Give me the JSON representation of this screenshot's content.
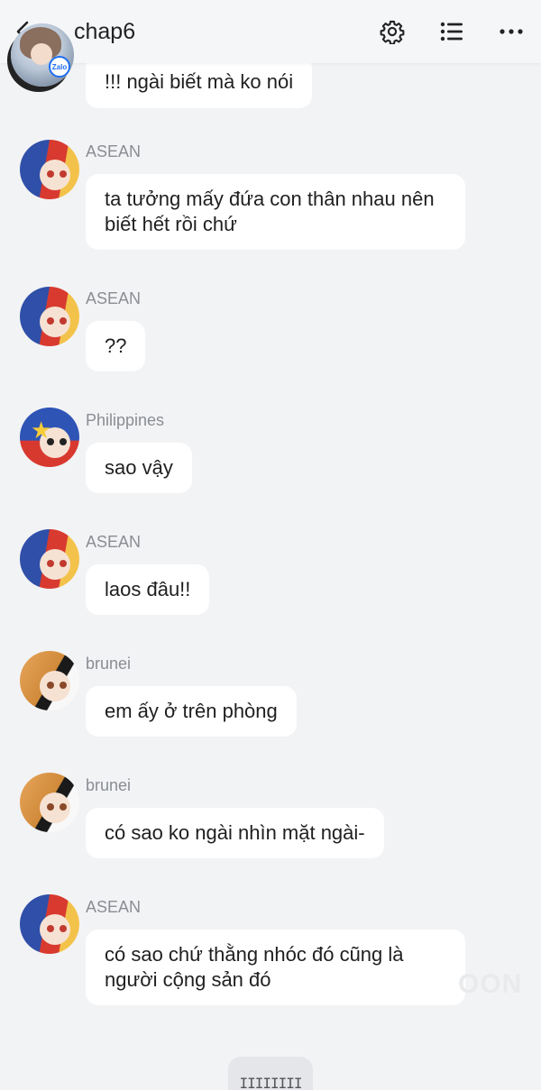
{
  "header": {
    "title": "chap6",
    "avatar_badge": "Zalo",
    "icons": [
      "back-icon",
      "gear-icon",
      "list-icon",
      "more-icon"
    ]
  },
  "messages": [
    {
      "sender": "",
      "text": "!!! ngài biết mà ko nói"
    },
    {
      "sender": "ASEAN",
      "text": "ta tưởng mấy đứa con thân nhau nên\nbiết hết rồi chứ"
    },
    {
      "sender": "ASEAN",
      "text": "??"
    },
    {
      "sender": "Philippines",
      "text": "sao vậy"
    },
    {
      "sender": "ASEAN",
      "text": "laos đâu!!"
    },
    {
      "sender": "brunei",
      "text": "em ấy ở trên phòng"
    },
    {
      "sender": "brunei",
      "text": "có sao ko ngài nhìn mặt ngài-"
    },
    {
      "sender": "ASEAN",
      "text": "có sao chứ thằng nhóc đó cũng là\nngười cộng sản đó"
    }
  ],
  "watermark": "OON",
  "bottom_handle": "IIIIIIII",
  "colors": {
    "background": "#f2f3f5",
    "bubble": "#ffffff",
    "sender_name": "#8a8d93",
    "badge_blue": "#1e6ff1"
  }
}
